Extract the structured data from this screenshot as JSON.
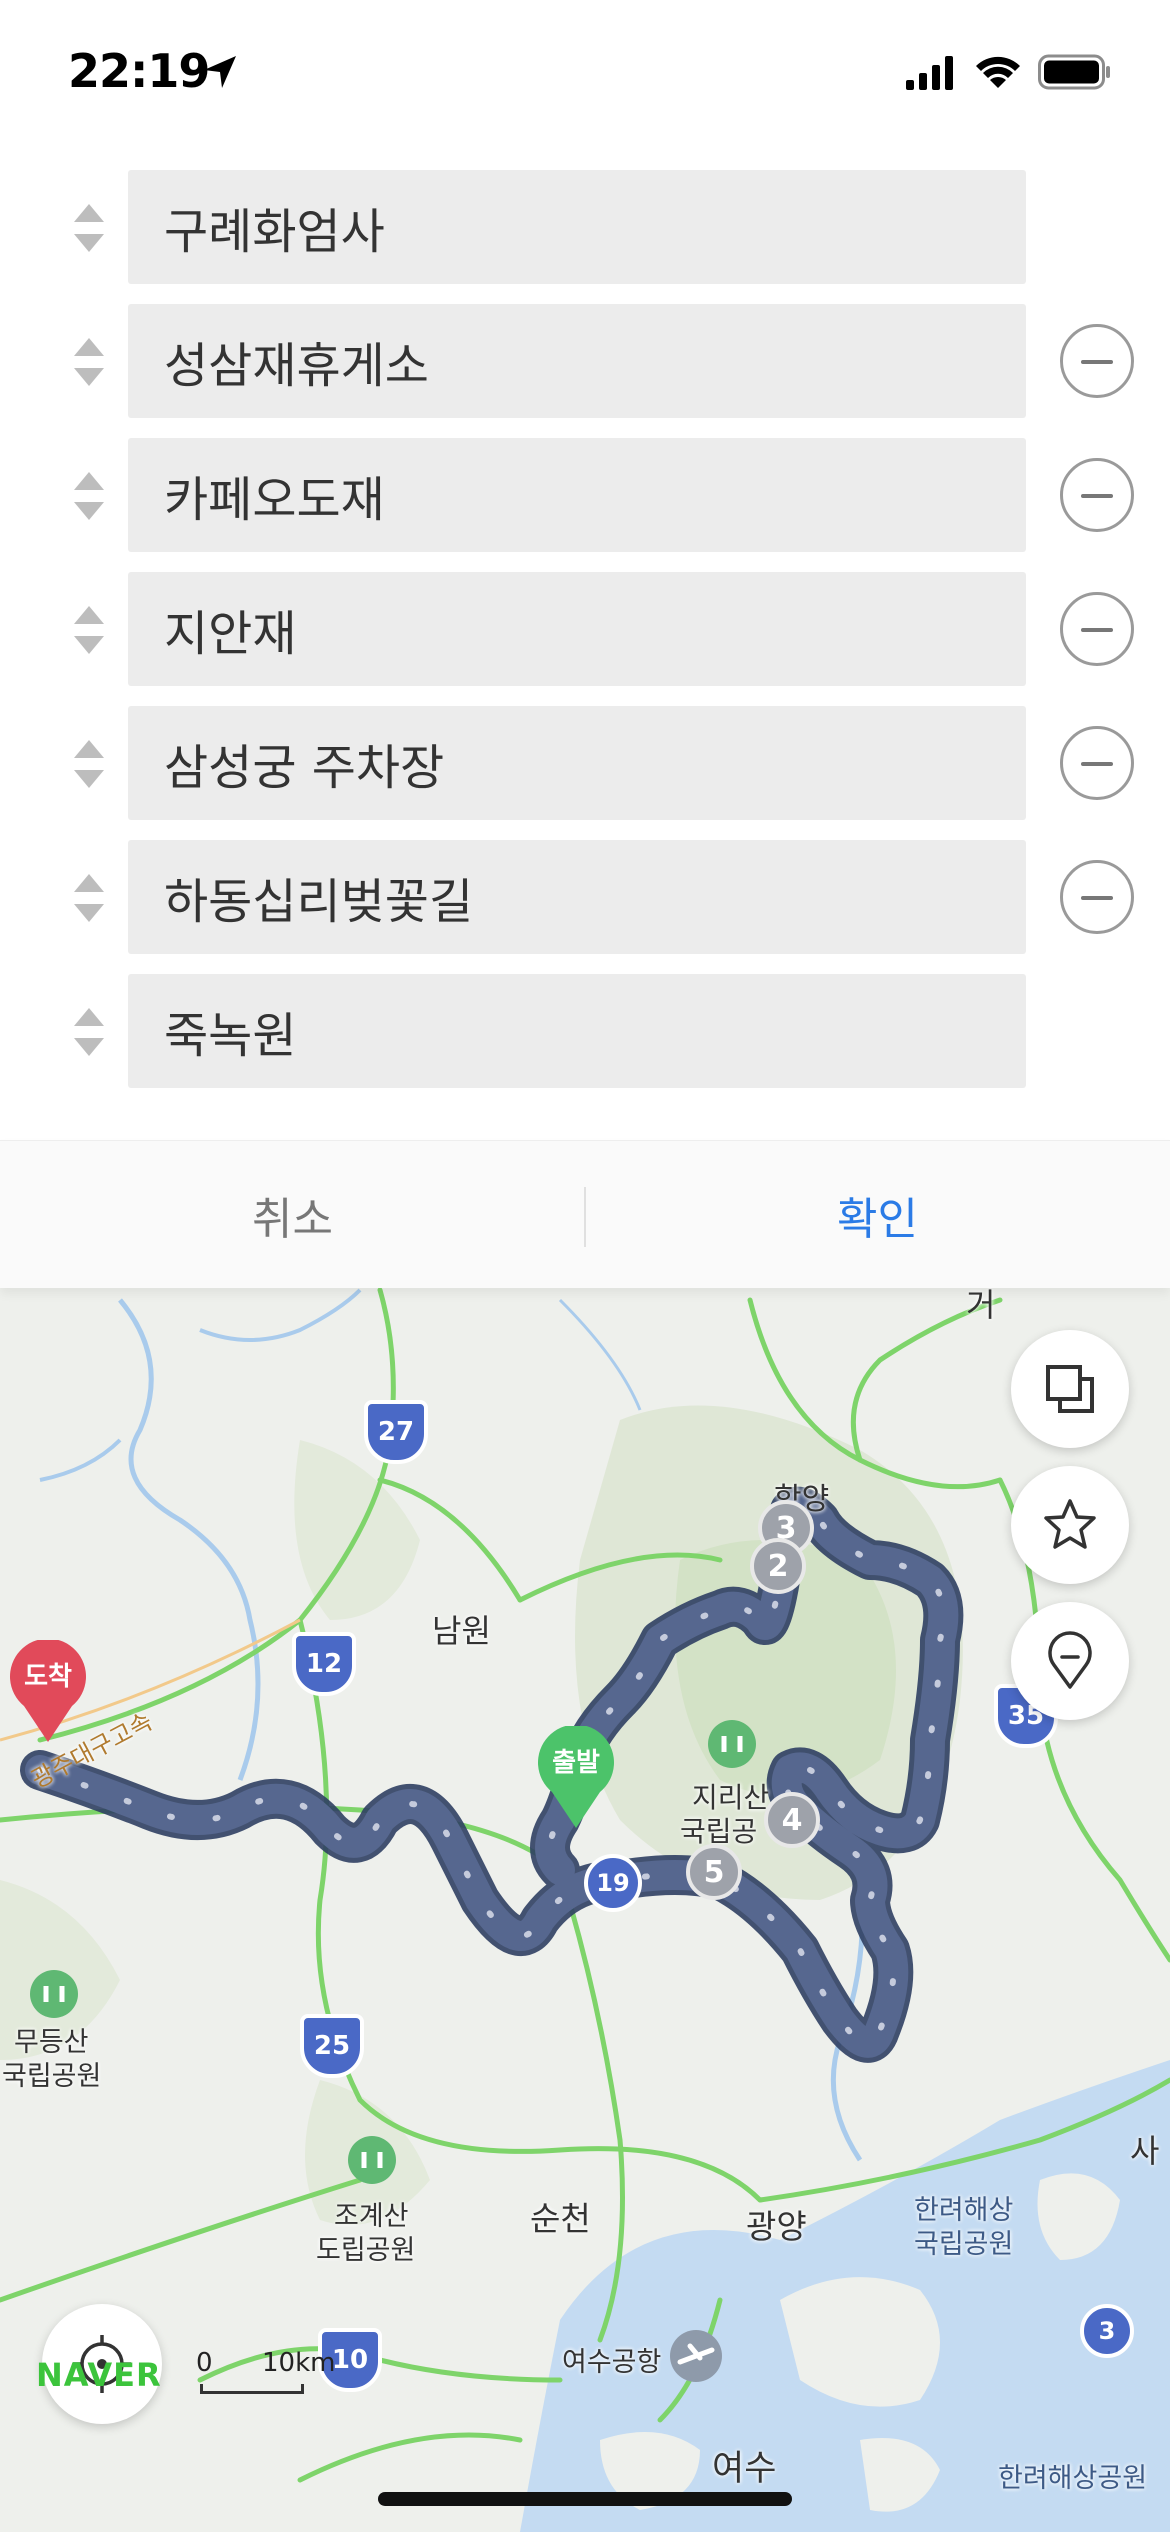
{
  "status_bar": {
    "time": "22:19"
  },
  "waypoints": [
    {
      "name": "구례화엄사",
      "removable": false
    },
    {
      "name": "성삼재휴게소",
      "removable": true
    },
    {
      "name": "카페오도재",
      "removable": true
    },
    {
      "name": "지안재",
      "removable": true
    },
    {
      "name": "삼성궁 주차장",
      "removable": true
    },
    {
      "name": "하동십리벚꽃길",
      "removable": true
    },
    {
      "name": "죽녹원",
      "removable": false
    }
  ],
  "actions": {
    "cancel": "취소",
    "confirm": "확인"
  },
  "map": {
    "labels": {
      "namwon": "남원",
      "hamyang": "함양",
      "jirisan": "지리산",
      "jirisan_park": "국립공",
      "mudeungsan": "무등산",
      "mudeungsan_park": "국립공원",
      "jogyesan": "조계산",
      "jogyesan_park": "도립공원",
      "suncheon": "순천",
      "gwangyang": "광양",
      "hallyeo": "한려해상",
      "hallyeo_park": "국립공원",
      "yeosu_airport": "여수공항",
      "yeosu": "여수",
      "hallyeo_bottom": "한려해상공원",
      "highway": "광주대구고속",
      "sa": "사",
      "geo": "거"
    },
    "route_shields": [
      "27",
      "12",
      "35",
      "25",
      "10",
      "19",
      "3"
    ],
    "markers": {
      "start": "출발",
      "end": "도착",
      "stops": [
        "2",
        "3",
        "4",
        "5"
      ]
    },
    "scale": {
      "zero": "0",
      "distance": "10km"
    },
    "logo": "NAVER"
  },
  "colors": {
    "route": "#56678f",
    "confirm": "#2b7be6",
    "start": "#4cc36a",
    "end": "#e14a5a",
    "water": "#c4dbf2",
    "road": "#7ed46a"
  }
}
